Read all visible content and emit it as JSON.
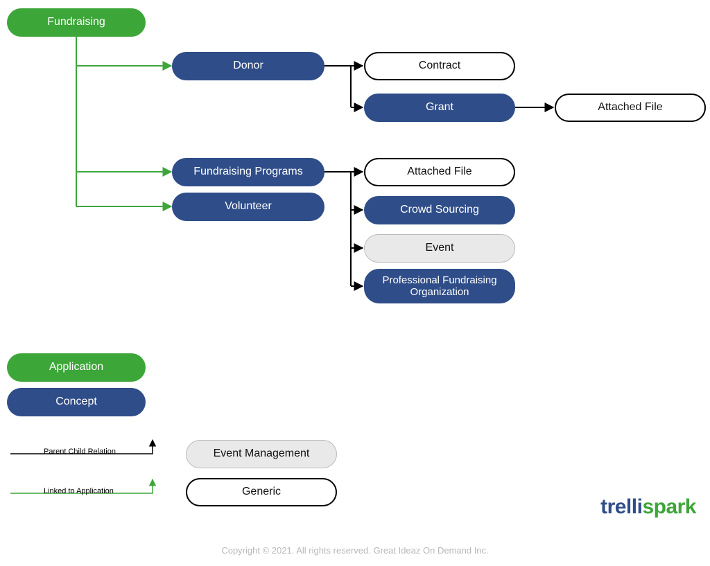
{
  "nodes": {
    "root": "Fundraising",
    "donor": "Donor",
    "contract": "Contract",
    "grant": "Grant",
    "attached_file_1": "Attached File",
    "fundraising_programs": "Fundraising Programs",
    "volunteer": "Volunteer",
    "attached_file_2": "Attached File",
    "crowd_sourcing": "Crowd Sourcing",
    "event": "Event",
    "pfo": "Professional Fundraising Organization"
  },
  "legend": {
    "application": "Application",
    "concept": "Concept",
    "parent_child": "Parent Child Relation",
    "linked_to_app": "Linked to Application",
    "event_management": "Event Management",
    "generic": "Generic"
  },
  "logo": {
    "part1": "trelli",
    "part2": "spark"
  },
  "footer": "Copyright © 2021. All rights reserved. Great Ideaz On Demand Inc."
}
